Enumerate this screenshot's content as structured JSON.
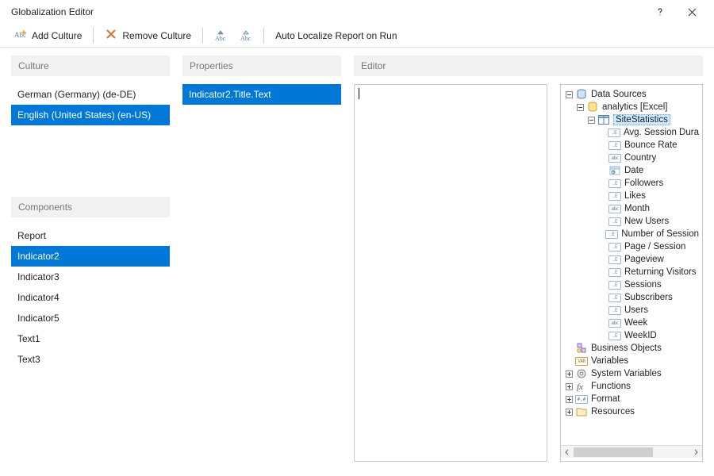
{
  "window": {
    "title": "Globalization Editor"
  },
  "toolbar": {
    "add_culture": "Add Culture",
    "remove_culture": "Remove Culture",
    "auto_localize": "Auto Localize Report on Run"
  },
  "sections": {
    "culture": "Culture",
    "components": "Components",
    "properties": "Properties",
    "editor": "Editor"
  },
  "cultures": [
    {
      "label": "German (Germany) (de-DE)",
      "selected": false
    },
    {
      "label": "English (United States) (en-US)",
      "selected": true
    }
  ],
  "components": [
    {
      "label": "Report",
      "selected": false
    },
    {
      "label": "Indicator2",
      "selected": true
    },
    {
      "label": "Indicator3",
      "selected": false
    },
    {
      "label": "Indicator4",
      "selected": false
    },
    {
      "label": "Indicator5",
      "selected": false
    },
    {
      "label": "Text1",
      "selected": false
    },
    {
      "label": "Text3",
      "selected": false
    }
  ],
  "properties": [
    {
      "label": "Indicator2.Title.Text",
      "selected": true
    }
  ],
  "editor_value": "",
  "tree": {
    "root": {
      "label": "Data Sources",
      "children": [
        {
          "label": "analytics [Excel]",
          "kind": "datasource",
          "children": [
            {
              "label": "SiteStatistics",
              "kind": "table",
              "selected": true,
              "fields": [
                {
                  "label": "Avg. Session Dura",
                  "type": "float"
                },
                {
                  "label": "Bounce Rate",
                  "type": "float"
                },
                {
                  "label": "Country",
                  "type": "string"
                },
                {
                  "label": "Date",
                  "type": "date"
                },
                {
                  "label": "Followers",
                  "type": "float"
                },
                {
                  "label": "Likes",
                  "type": "float"
                },
                {
                  "label": "Month",
                  "type": "string"
                },
                {
                  "label": "New Users",
                  "type": "float"
                },
                {
                  "label": "Number of Session",
                  "type": "float"
                },
                {
                  "label": "Page / Session",
                  "type": "float"
                },
                {
                  "label": "Pageview",
                  "type": "float"
                },
                {
                  "label": "Returning Visitors",
                  "type": "float"
                },
                {
                  "label": "Sessions",
                  "type": "float"
                },
                {
                  "label": "Subscribers",
                  "type": "float"
                },
                {
                  "label": "Users",
                  "type": "float"
                },
                {
                  "label": "Week",
                  "type": "string"
                },
                {
                  "label": "WeekID",
                  "type": "float"
                }
              ]
            }
          ]
        }
      ]
    },
    "siblings": [
      {
        "label": "Business Objects",
        "kind": "bizobj",
        "expandable": false
      },
      {
        "label": "Variables",
        "kind": "variables",
        "expandable": false
      },
      {
        "label": "System Variables",
        "kind": "sysvar",
        "expandable": true
      },
      {
        "label": "Functions",
        "kind": "functions",
        "expandable": true
      },
      {
        "label": "Format",
        "kind": "format",
        "expandable": true
      },
      {
        "label": "Resources",
        "kind": "resources",
        "expandable": true
      }
    ]
  }
}
